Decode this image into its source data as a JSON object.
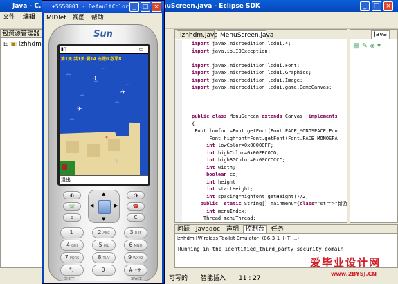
{
  "eclipse": {
    "title": "Java - C...                         aewth\\2.5.2\\apps\\lzhhdm\\src\\MenuScreen.java - Eclipse SDK",
    "menu": [
      "文件",
      "编辑"
    ],
    "package_explorer": {
      "header": "包资源管理器",
      "items": [
        "lzhhdm"
      ]
    },
    "editor_tabs": [
      "lzhhdm.java",
      "MenuScreen.java"
    ],
    "code_lines": [
      "import javax.microedition.lcdui.*;",
      "import java.io.IOException;",
      "",
      "import javax.microedition.lcdui.Font;",
      "import javax.microedition.lcdui.Graphics;",
      "import javax.microedition.lcdui.Image;",
      "import javax.microedition.lcdui.game.GameCanvas;",
      "",
      "",
      "",
      "public class MenuScreen extends Canvas  implements",
      "{",
      " Font lowfont=Font.getFont(Font.FACE_MONOSPACE,Fon",
      "      Font highfont=Font.getFont(Font.FACE_MONOSPA",
      "     int lowColor=0x000OCFF;",
      "     int highColor=0x00FFCOCO;",
      "     int highBGColor=0x00CCCCCC;",
      "     int width;",
      "     boolean co;",
      "     int height;",
      "     int startHeight;",
      "     int spacing=highfont.getHeight()/2;",
      "   public  static String[] mainmenu={\"新游戏\",\"帮",
      "     int menuIndex;",
      "    Thread menuThread;",
      "    private Command ok=new Command(\"ok\",Command.OK"
    ],
    "outline_tab": "Java",
    "console": {
      "tabs": [
        "问题",
        "Javadoc",
        "声明",
        "控制台",
        "任务"
      ],
      "subtitle": "lzhhdm [Wireless Toolkit Emulator] (06-3-1 下午 ...)",
      "line": "Running in the identified_third_party security domain"
    },
    "status": {
      "writable": "可写的",
      "insert_mode": "智能插入",
      "position": "11 : 27"
    }
  },
  "emulator": {
    "title": "+5550001 - DefaultColorP...",
    "menu": [
      "MIDlet",
      "视图",
      "帮助"
    ],
    "brand": "Sun",
    "hud": "第1关 共1关 剩14 击毁0 敌军8",
    "softkey_label": "退出",
    "keys": [
      {
        "main": "1",
        "sub": ""
      },
      {
        "main": "2",
        "sub": "ABC"
      },
      {
        "main": "3",
        "sub": "DEF"
      },
      {
        "main": "4",
        "sub": "GHI"
      },
      {
        "main": "5",
        "sub": "JKL"
      },
      {
        "main": "6",
        "sub": "MNO"
      },
      {
        "main": "7",
        "sub": "PQRS"
      },
      {
        "main": "8",
        "sub": "TUV"
      },
      {
        "main": "9",
        "sub": "WXYZ"
      },
      {
        "main": "*.",
        "sub": ""
      },
      {
        "main": "0",
        "sub": ""
      },
      {
        "main": "# -+",
        "sub": ""
      }
    ],
    "bottom_labels": {
      "shift": "SHIFT",
      "space": "SPACE"
    }
  },
  "watermark": {
    "text": "爱毕业设计网",
    "url": "www.2BYSJ.CN"
  }
}
